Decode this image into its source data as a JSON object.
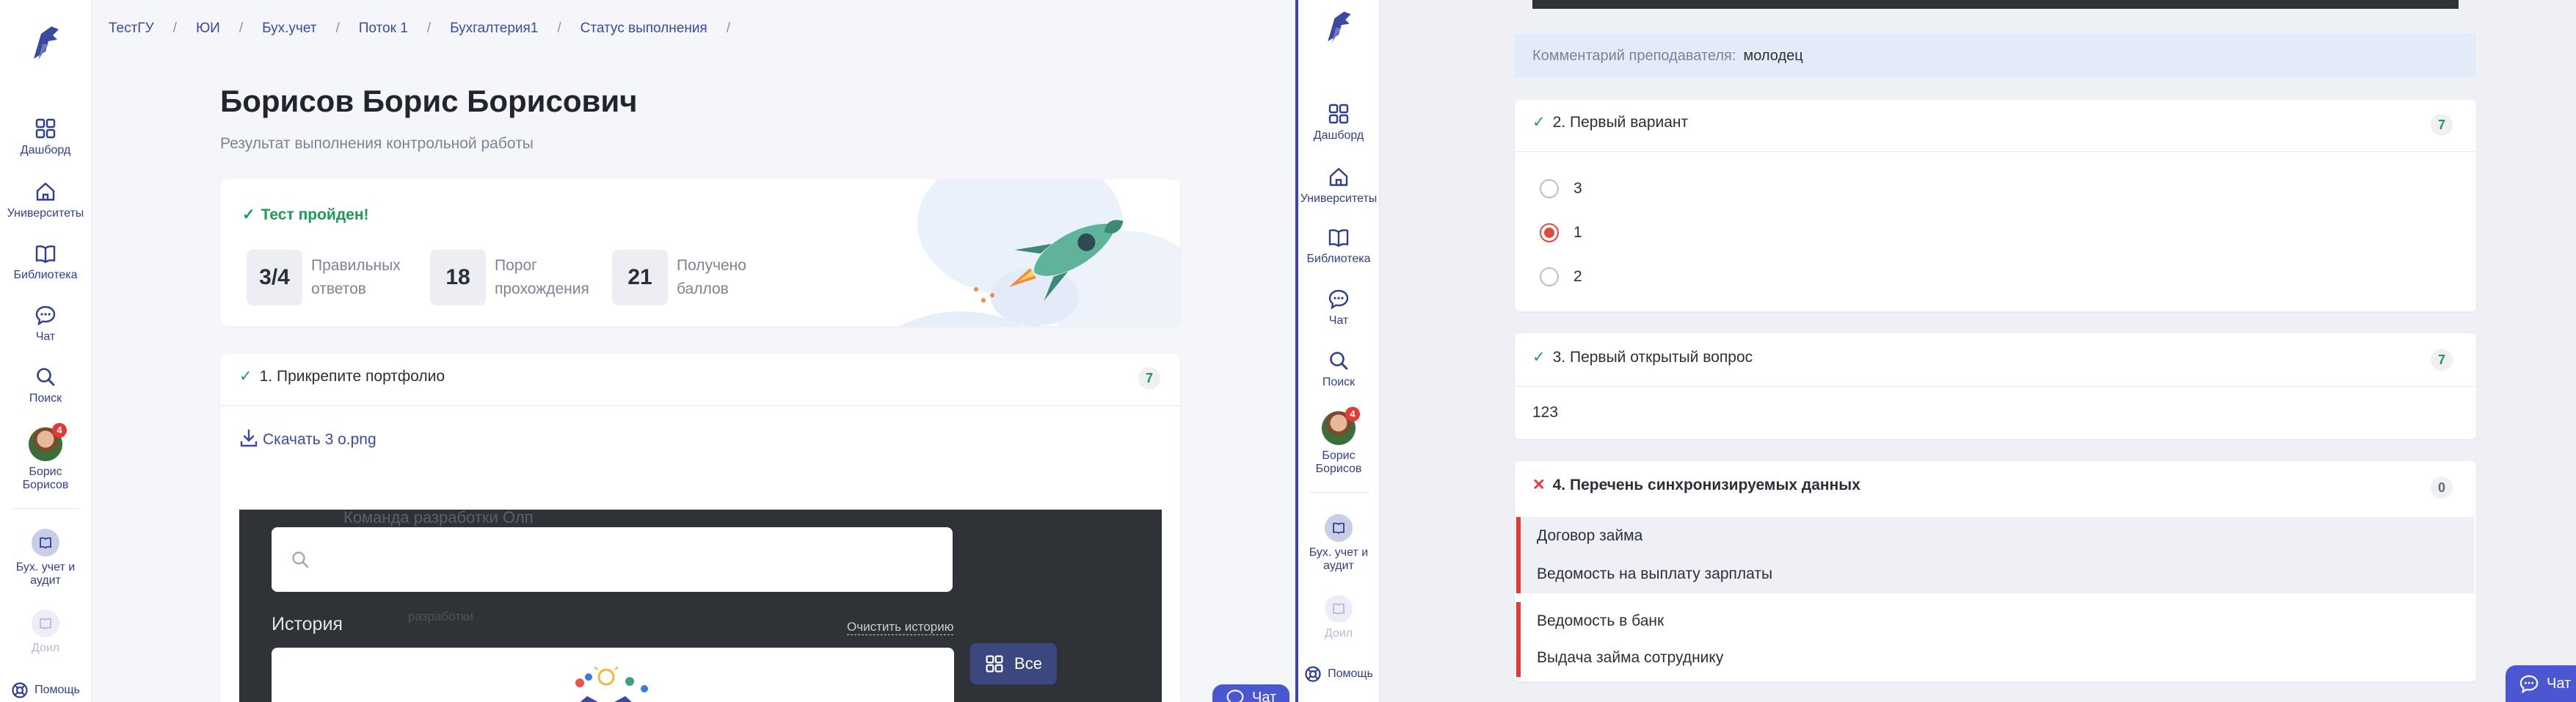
{
  "colors": {
    "accent": "#3b4aa0",
    "success": "#1d9b55",
    "error": "#e53935",
    "divider": "#3d3fbd"
  },
  "left": {
    "sidebar": {
      "items": [
        {
          "label": "Дашборд",
          "icon": "grid-icon"
        },
        {
          "label": "Университеты",
          "icon": "home-icon"
        },
        {
          "label": "Библиотека",
          "icon": "book-icon"
        },
        {
          "label": "Чат",
          "icon": "chat-icon"
        },
        {
          "label": "Поиск",
          "icon": "search-icon"
        }
      ],
      "user": {
        "name_line1": "Борис",
        "name_line2": "Борисов",
        "badge": "4"
      },
      "course": {
        "line1": "Бух. учет и",
        "line2": "аудит"
      },
      "course_faded": "Доил",
      "help": "Помощь"
    },
    "breadcrumbs": [
      "ТестГУ",
      "ЮИ",
      "Бух.учет",
      "Поток 1",
      "Бухгалтерия1",
      "Статус выполнения"
    ],
    "page_title": "Борисов Борис Борисович",
    "page_subtitle": "Результат выполнения контрольной работы",
    "result": {
      "status": "Тест пройден!",
      "stats": [
        {
          "value": "3/4",
          "line1": "Правильных",
          "line2": "ответов"
        },
        {
          "value": "18",
          "line1": "Порог",
          "line2": "прохождения"
        },
        {
          "value": "21",
          "line1": "Получено",
          "line2": "баллов"
        }
      ]
    },
    "question1": {
      "number": "1.",
      "title": "Прикрепите портфолио",
      "score": "7",
      "download_label": "Скачать 3 о.png"
    },
    "overlay": {
      "ghost_title": "Команда разработки Олп",
      "ghost_sub": "разработки",
      "search_placeholder": "",
      "history_label": "История",
      "clear_history": "Очистить историю",
      "all_button": "Все"
    },
    "chat_button": "Чат"
  },
  "right": {
    "sidebar": {
      "items": [
        {
          "label": "Дашборд",
          "icon": "grid-icon"
        },
        {
          "label": "Университеты",
          "icon": "home-icon"
        },
        {
          "label": "Библиотека",
          "icon": "book-icon"
        },
        {
          "label": "Чат",
          "icon": "chat-icon"
        },
        {
          "label": "Поиск",
          "icon": "search-icon"
        }
      ],
      "user": {
        "name_line1": "Борис",
        "name_line2": "Борисов",
        "badge": "4"
      },
      "course": {
        "line1": "Бух. учет и",
        "line2": "аудит"
      },
      "course_faded": "Доил",
      "help": "Помощь"
    },
    "comment": {
      "label": "Комментарий преподавателя:",
      "value": "молодец"
    },
    "question2": {
      "number": "2.",
      "title": "Первый вариант",
      "score": "7",
      "options": [
        "3",
        "1",
        "2"
      ],
      "selected": "1"
    },
    "question3": {
      "number": "3.",
      "title": "Первый открытый вопрос",
      "score": "7",
      "answer": "123"
    },
    "question4": {
      "number": "4.",
      "title": "Перечень синхронизируемых данных",
      "score": "0",
      "items": [
        "Договор займа",
        "Ведомость на выплату зарплаты",
        "Ведомость в банк",
        "Выдача займа сотруднику"
      ]
    },
    "chat_button": "Чат"
  }
}
